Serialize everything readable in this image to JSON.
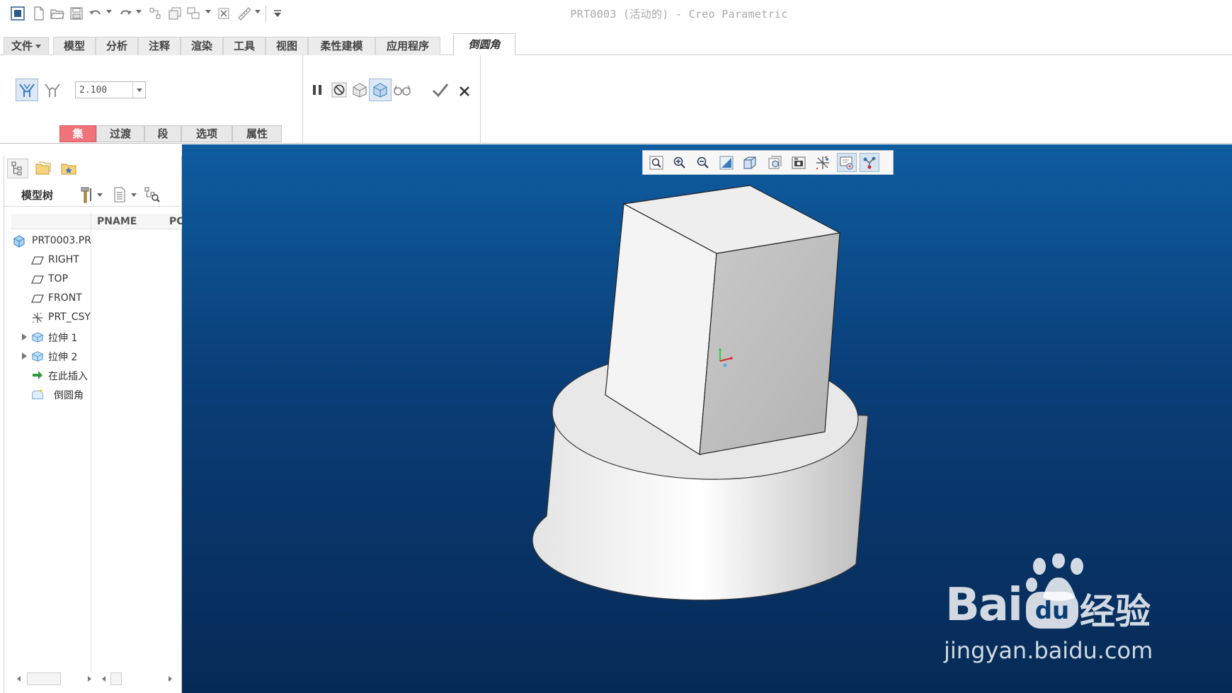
{
  "window": {
    "title": "PRT0003 (活动的) - Creo Parametric"
  },
  "ribbon_tabs": [
    {
      "label": "文件"
    },
    {
      "label": "模型"
    },
    {
      "label": "分析"
    },
    {
      "label": "注释"
    },
    {
      "label": "渲染"
    },
    {
      "label": "工具"
    },
    {
      "label": "视图"
    },
    {
      "label": "柔性建模"
    },
    {
      "label": "应用程序"
    },
    {
      "label": "倒圆角",
      "active": true
    }
  ],
  "round_tool": {
    "radius_value": "2.100",
    "subtabs": [
      {
        "label": "集",
        "active": true
      },
      {
        "label": "过渡"
      },
      {
        "label": "段"
      },
      {
        "label": "选项"
      },
      {
        "label": "属性"
      }
    ]
  },
  "model_tree": {
    "title": "模型树",
    "columns": [
      "PNAME",
      "PC"
    ],
    "items": [
      {
        "label": "PRT0003.PR",
        "icon": "part-icon"
      },
      {
        "label": "RIGHT",
        "icon": "datum-plane-icon"
      },
      {
        "label": "TOP",
        "icon": "datum-plane-icon"
      },
      {
        "label": "FRONT",
        "icon": "datum-plane-icon"
      },
      {
        "label": "PRT_CSY",
        "icon": "coordinate-system-icon"
      },
      {
        "label": "拉伸 1",
        "icon": "extrude-icon",
        "expandable": true
      },
      {
        "label": "拉伸 2",
        "icon": "extrude-icon",
        "expandable": true
      },
      {
        "label": "在此插入",
        "icon": "insert-here-arrow-icon"
      },
      {
        "label": "倒圆角",
        "icon": "round-feature-icon"
      }
    ]
  },
  "watermark": {
    "word": "Bai",
    "cn": "经验",
    "url": "jingyan.baidu.com"
  },
  "colors": {
    "viewport_top": "#0e5c9f",
    "viewport_bottom": "#062a56",
    "active_subtab": "#f0737a"
  }
}
